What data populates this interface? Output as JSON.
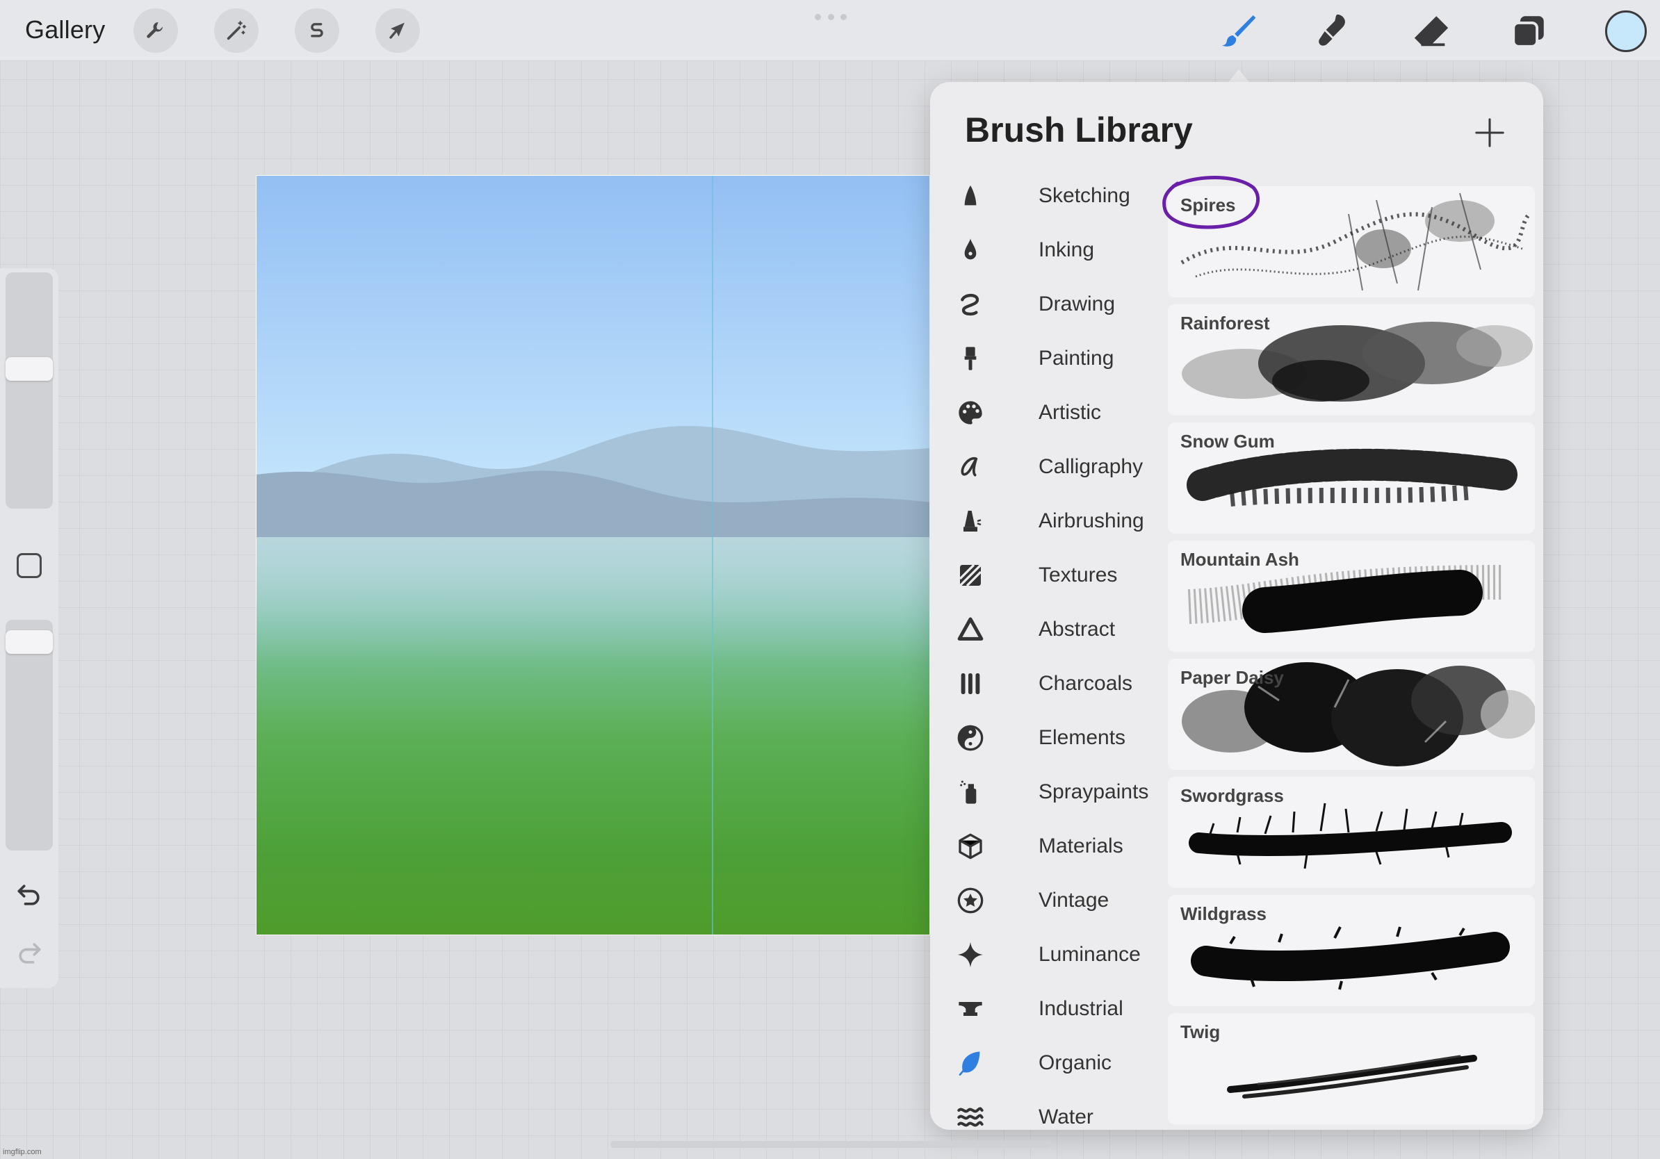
{
  "topbar": {
    "gallery_label": "Gallery",
    "left_tools": [
      {
        "name": "actions",
        "icon": "wrench-icon"
      },
      {
        "name": "adjustments",
        "icon": "magic-wand-icon"
      },
      {
        "name": "selection",
        "icon": "selection-s-icon"
      },
      {
        "name": "transform",
        "icon": "arrow-cursor-icon"
      }
    ],
    "right_tools": [
      {
        "name": "brush",
        "icon": "brush-icon",
        "active": true,
        "color": "#2f7fe0"
      },
      {
        "name": "smudge",
        "icon": "smudge-icon"
      },
      {
        "name": "eraser",
        "icon": "eraser-icon"
      },
      {
        "name": "layers",
        "icon": "layers-icon"
      }
    ],
    "current_color": "#c7e7fb"
  },
  "sidebar": {
    "brush_size_level": 0.6,
    "opacity_level": 0.95
  },
  "brush_library": {
    "title": "Brush Library",
    "categories": [
      {
        "label": "Sketching",
        "icon": "pencil-tip-icon"
      },
      {
        "label": "Inking",
        "icon": "pen-nib-icon"
      },
      {
        "label": "Drawing",
        "icon": "squiggle-icon"
      },
      {
        "label": "Painting",
        "icon": "paint-brush-icon"
      },
      {
        "label": "Artistic",
        "icon": "palette-icon"
      },
      {
        "label": "Calligraphy",
        "icon": "calligraphy-a-icon"
      },
      {
        "label": "Airbrushing",
        "icon": "airbrush-icon"
      },
      {
        "label": "Textures",
        "icon": "hatch-texture-icon"
      },
      {
        "label": "Abstract",
        "icon": "triangle-icon"
      },
      {
        "label": "Charcoals",
        "icon": "charcoal-sticks-icon"
      },
      {
        "label": "Elements",
        "icon": "yin-yang-icon"
      },
      {
        "label": "Spraypaints",
        "icon": "spray-can-icon"
      },
      {
        "label": "Materials",
        "icon": "cube-icon"
      },
      {
        "label": "Vintage",
        "icon": "star-circle-icon"
      },
      {
        "label": "Luminance",
        "icon": "sparkle-icon"
      },
      {
        "label": "Industrial",
        "icon": "anvil-icon"
      },
      {
        "label": "Organic",
        "icon": "leaf-icon"
      },
      {
        "label": "Water",
        "icon": "waves-icon"
      }
    ],
    "active_category": "Organic",
    "brushes": [
      {
        "name": "Spires"
      },
      {
        "name": "Rainforest"
      },
      {
        "name": "Snow Gum"
      },
      {
        "name": "Mountain Ash"
      },
      {
        "name": "Paper Daisy"
      },
      {
        "name": "Swordgrass"
      },
      {
        "name": "Wildgrass"
      },
      {
        "name": "Twig"
      }
    ],
    "highlighted_brush": "Spires",
    "highlight_color": "#6a1fa8"
  },
  "watermark": "imgflip.com"
}
